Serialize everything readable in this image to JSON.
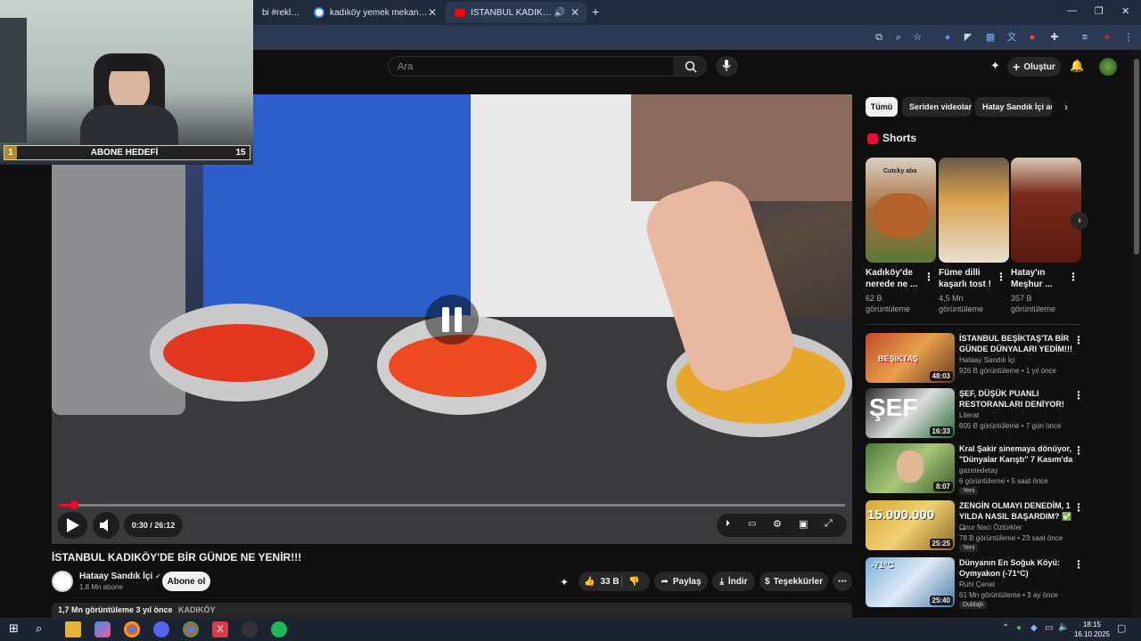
{
  "browser": {
    "tabs": [
      {
        "title": "bi #reklam",
        "active": false
      },
      {
        "title": "kadıköy yemek mekanları - Goo",
        "active": false
      },
      {
        "title": "İSTANBUL KADIKÖY'DE BİR",
        "active": true
      }
    ],
    "new_tab_symbol": "+",
    "window_controls": [
      "—",
      "❐",
      "✕"
    ]
  },
  "youtube": {
    "search_placeholder": "Ara",
    "create_label": "Oluştur"
  },
  "stream_overlay": {
    "goal_label": "ABONE HEDEFİ",
    "goal_current": "1",
    "goal_target": "15"
  },
  "player": {
    "time": "0:30 / 26:12",
    "progress": 0.019
  },
  "video": {
    "title": "İSTANBUL KADIKÖY'DE BİR GÜNDE NE YENİR!!!",
    "channel": "Hataay Sandık İçi",
    "subscribers": "1,8 Mn abone",
    "subscribe_label": "Abone ol",
    "likes": "33 B",
    "share_label": "Paylaş",
    "download_label": "İndir",
    "thanks_label": "Teşekkürler",
    "desc_views": "1,7 Mn görüntüleme  3 yıl önce",
    "desc_tag": "KADIKÖY"
  },
  "sidebar": {
    "chips": [
      "Tümü",
      "Seriden videolar",
      "Hatay Sandık İçi adlı y"
    ],
    "shorts_header": "Shorts",
    "shorts": [
      {
        "title": "Kadıköy'de nerede ne ...",
        "views": "62 B görüntüleme",
        "thumb_text": "Cutcky aba"
      },
      {
        "title": "Füme dilli kaşarlı tost !",
        "views": "4,5 Mn görüntüleme",
        "thumb_text": ""
      },
      {
        "title": "Hatay'ın Meşhur ...",
        "views": "357 B görüntüleme",
        "thumb_text": ""
      }
    ],
    "recommended": [
      {
        "title": "İSTANBUL BEŞİKTAŞ'TA BİR GÜNDE DÜNYALARI YEDİM!!!",
        "channel": "Hataay Sandık İçi",
        "meta": "926 B görüntüleme • 1 yıl önce",
        "duration": "48:03",
        "thumb_text": "BEŞİKTAŞ",
        "badge": ""
      },
      {
        "title": "ŞEF, DÜŞÜK PUANLI RESTORANLARI DENİYOR!",
        "channel": "Literat",
        "meta": "605 B görüntüleme • 7 gün önce",
        "duration": "16:33",
        "thumb_text": "ŞEF",
        "badge": ""
      },
      {
        "title": "Kral Şakir sinemaya dönüyor, \"Dünyalar Karıştı\" 7 Kasım'da",
        "channel": "gazetedetay",
        "meta": "6 görüntüleme • 5 saat önce",
        "duration": "8:07",
        "thumb_text": "",
        "badge": "Yeni"
      },
      {
        "title": "ZENGİN OLMAYI DENEDİM, 1 YILDA NASIL BAŞARDIM? ✅ ...",
        "channel": "Onur Naci Öztürkler",
        "meta": "78 B görüntüleme • 23 saat önce",
        "duration": "25:25",
        "thumb_text": "15.000.000",
        "badge": "Yeni"
      },
      {
        "title": "Dünyanın En Soğuk Köyü: Oymyakon (-71°C)",
        "channel": "Ruhi Çenet",
        "meta": "61 Mn görüntüleme • 3 ay önce",
        "duration": "25:40",
        "thumb_text": "-71°C",
        "badge": "Dublajlı"
      }
    ]
  },
  "taskbar": {
    "time": "18:15",
    "date": "16.10.2025"
  },
  "colors": {
    "accent_red": "#ff0033",
    "bg": "#0f0f0f",
    "chip_bg": "#272727"
  }
}
